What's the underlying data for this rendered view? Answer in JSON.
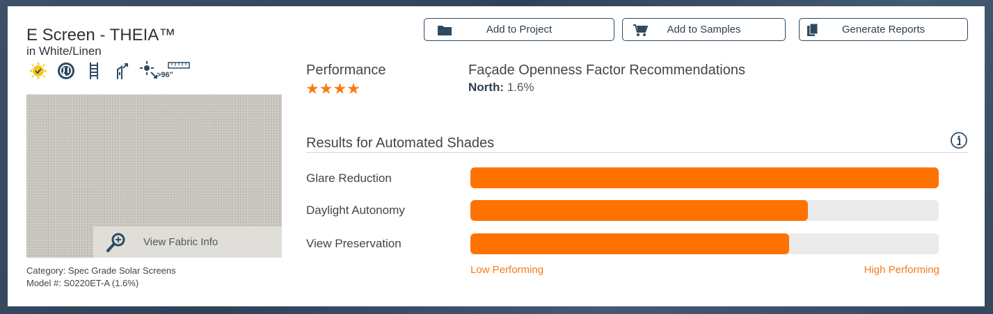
{
  "product": {
    "name": "E Screen - THEIA™",
    "color": "in White/Linen",
    "feature_icons": [
      "sun-certified-icon",
      "ul-certification-icon",
      "ladder-chain-icon",
      "antimicrobial-icon",
      "solar-heat-icon",
      "width-over-96-icon"
    ],
    "width_badge": ">96\"",
    "category_label": "Category:",
    "category": "Spec Grade Solar Screens",
    "model_label": "Model #:",
    "model": "S0220ET-A (1.6%)",
    "view_fabric_label": "View Fabric Info"
  },
  "actions": {
    "add_project": "Add to Project",
    "add_samples": "Add to Samples",
    "generate_reports": "Generate Reports"
  },
  "performance": {
    "label": "Performance",
    "rating": 4,
    "stars": "★★★★"
  },
  "facade": {
    "title": "Façade Openness Factor Recommendations",
    "direction": "North:",
    "value": "1.6%"
  },
  "results": {
    "title": "Results for Automated Shades",
    "metrics": [
      {
        "label": "Glare Reduction",
        "value": 1.0
      },
      {
        "label": "Daylight Autonomy",
        "value": 0.72
      },
      {
        "label": "View Preservation",
        "value": 0.68
      }
    ],
    "low_label": "Low Performing",
    "high_label": "High Performing"
  },
  "colors": {
    "accent": "#ff7200",
    "button_border": "#2c4864",
    "track": "#ebebeb",
    "background": "#3d5068"
  }
}
